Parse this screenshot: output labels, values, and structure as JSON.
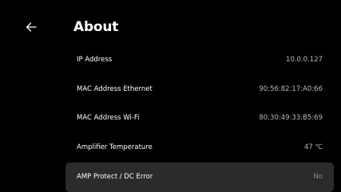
{
  "header": {
    "back_icon": "arrow-left-icon",
    "title": "About"
  },
  "info_rows": [
    {
      "label": "IP Address",
      "value": "10.0.0.127"
    },
    {
      "label": "MAC Address Ethernet",
      "value": "90:56:82:17:A0:66"
    },
    {
      "label": "MAC Address Wi-Fi",
      "value": "80:30:49:33:B5:69"
    },
    {
      "label": "Amplifier Temperature",
      "value": "47 ℃"
    },
    {
      "label": "AMP Protect / DC Error",
      "value": "No"
    }
  ],
  "colors": {
    "background": "#000000",
    "selected_row": "#2b2b2b",
    "text_primary": "#ffffff",
    "text_secondary": "#b9b9b9"
  }
}
